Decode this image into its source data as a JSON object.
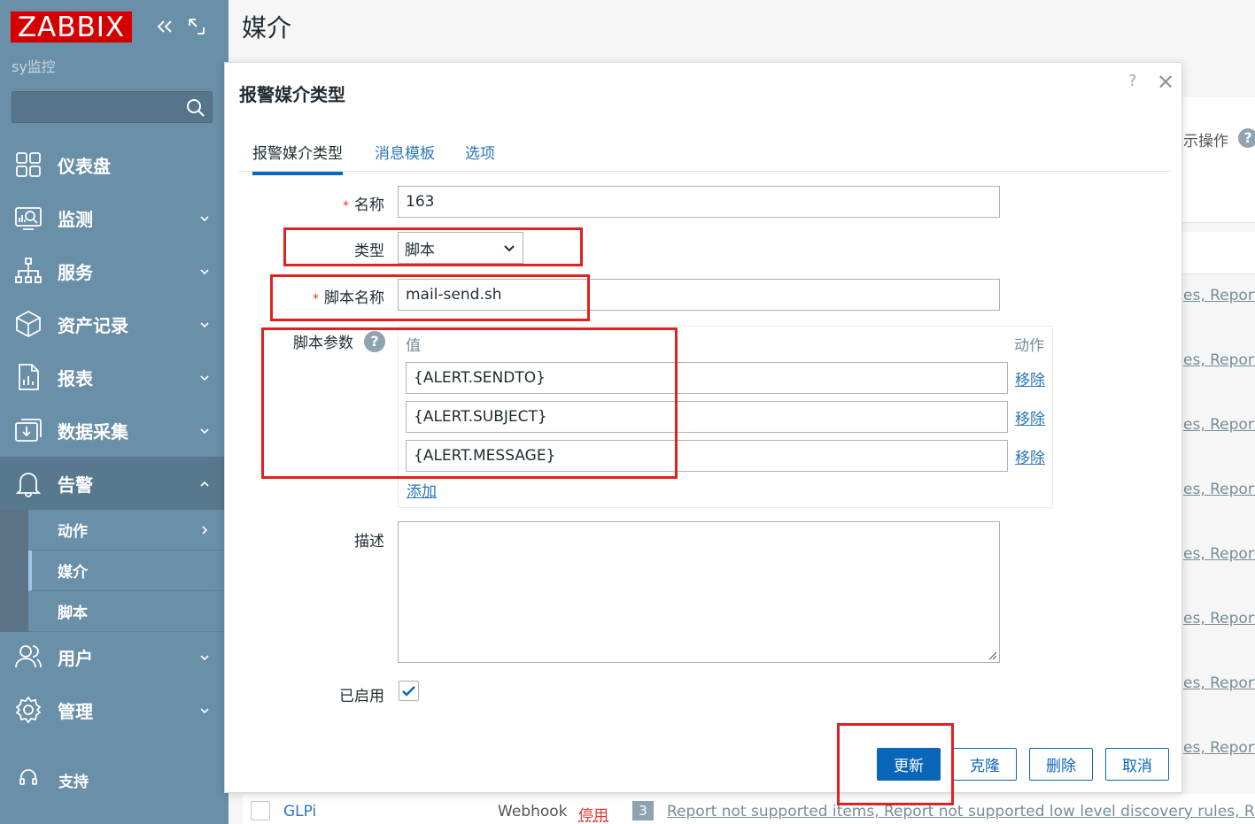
{
  "sidebar": {
    "logo": "ZABBIX",
    "subtitle": "sy监控",
    "search_placeholder": "",
    "items": [
      {
        "label": "仪表盘",
        "icon": "dashboard-icon"
      },
      {
        "label": "监测",
        "icon": "monitoring-icon"
      },
      {
        "label": "服务",
        "icon": "services-icon"
      },
      {
        "label": "资产记录",
        "icon": "inventory-icon"
      },
      {
        "label": "报表",
        "icon": "reports-icon"
      },
      {
        "label": "数据采集",
        "icon": "data-collection-icon"
      },
      {
        "label": "告警",
        "icon": "bell-icon"
      },
      {
        "label": "用户",
        "icon": "users-icon"
      },
      {
        "label": "管理",
        "icon": "gear-icon"
      }
    ],
    "alerts_sub": [
      "动作",
      "媒介",
      "脚本"
    ],
    "support": "支持"
  },
  "main": {
    "title": "媒介",
    "ops_header": "示操作",
    "bg_report": "es, Report",
    "bottom_row": {
      "name": "GLPi",
      "type": "Webhook",
      "status": "停用",
      "count": "3",
      "report": "Report not supported items, Report not supported low level discovery rules, Report"
    }
  },
  "dialog": {
    "title": "报警媒介类型",
    "help": "?",
    "tabs": [
      "报警媒介类型",
      "消息模板",
      "选项"
    ],
    "name_label": "名称",
    "name_value": "163",
    "type_label": "类型",
    "type_value": "脚本",
    "script_label": "脚本名称",
    "script_value": "mail-send.sh",
    "params_label": "脚本参数",
    "params_col_value": "值",
    "params_col_action": "动作",
    "params": [
      "{ALERT.SENDTO}",
      "{ALERT.SUBJECT}",
      "{ALERT.MESSAGE}"
    ],
    "remove_label": "移除",
    "add_label": "添加",
    "desc_label": "描述",
    "desc_value": "",
    "enabled_label": "已启用",
    "enabled": true,
    "buttons": {
      "update": "更新",
      "clone": "克隆",
      "delete": "删除",
      "cancel": "取消"
    }
  },
  "colors": {
    "sidebar": "#6a8fa8",
    "logo": "#d40000",
    "primary": "#0a66b8",
    "highlight": "#e0211f"
  }
}
